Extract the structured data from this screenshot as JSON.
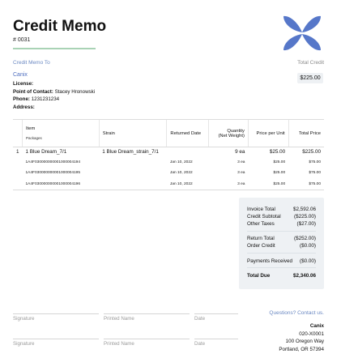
{
  "header": {
    "title": "Credit Memo",
    "memo_number": "# 0031"
  },
  "customer": {
    "section_label": "Credit Memo To",
    "name": "Canix",
    "license_label": "License:",
    "license_value": "",
    "contact_label": "Point of Contact:",
    "contact_value": "Stacey Hronowski",
    "phone_label": "Phone:",
    "phone_value": "1231231234",
    "address_label": "Address:",
    "address_value": ""
  },
  "total_credit": {
    "label": "Total Credit",
    "value": "$225.00"
  },
  "table": {
    "headers": {
      "item": "Item",
      "packages": "Packages",
      "strain": "Strain",
      "returned_date": "Returned Date",
      "quantity_line1": "Quantity",
      "quantity_line2": "(Net Weight)",
      "price_per_unit": "Price per Unit",
      "total_price": "Total Price"
    },
    "line": {
      "index": "1",
      "item": "1 Blue Dream_7/1",
      "strain": "1 Blue Dream_strain_7/1",
      "qty": "9 ea",
      "price": "$25.00",
      "total": "$225.00"
    },
    "packages": [
      {
        "tag": "1A4F030000000001000004194",
        "date": "Jan 10, 2022",
        "qty": "3 ea",
        "price": "$25.00",
        "total": "$75.00"
      },
      {
        "tag": "1A4F030000000001000004195",
        "date": "Jan 10, 2022",
        "qty": "3 ea",
        "price": "$25.00",
        "total": "$75.00"
      },
      {
        "tag": "1A4F030000000001000004196",
        "date": "Jan 10, 2022",
        "qty": "3 ea",
        "price": "$25.00",
        "total": "$75.00"
      }
    ]
  },
  "totals": {
    "invoice_total_label": "Invoice Total",
    "invoice_total": "$2,592.06",
    "credit_subtotal_label": "Credit Subtotal",
    "credit_subtotal": "($225.00)",
    "other_taxes_label": "Other Taxes",
    "other_taxes": "($27.00)",
    "return_total_label": "Return Total",
    "return_total": "($252.00)",
    "order_credit_label": "Order Credit",
    "order_credit": "($0.00)",
    "payments_received_label": "Payments Received",
    "payments_received": "($0.00)",
    "total_due_label": "Total Due",
    "total_due": "$2,340.06"
  },
  "signatures": {
    "signature": "Signature",
    "printed_name": "Printed Name",
    "date": "Date"
  },
  "contact": {
    "question": "Questions? Contact us.",
    "name": "Canix",
    "line1": "020-X0001",
    "line2": "100 Oregon Way",
    "line3": "Portland, OR 57394"
  },
  "colors": {
    "accent_blue": "#4f6fc0",
    "logo_blue": "#5677c9",
    "title_rule_green": "#a9d3b5"
  }
}
